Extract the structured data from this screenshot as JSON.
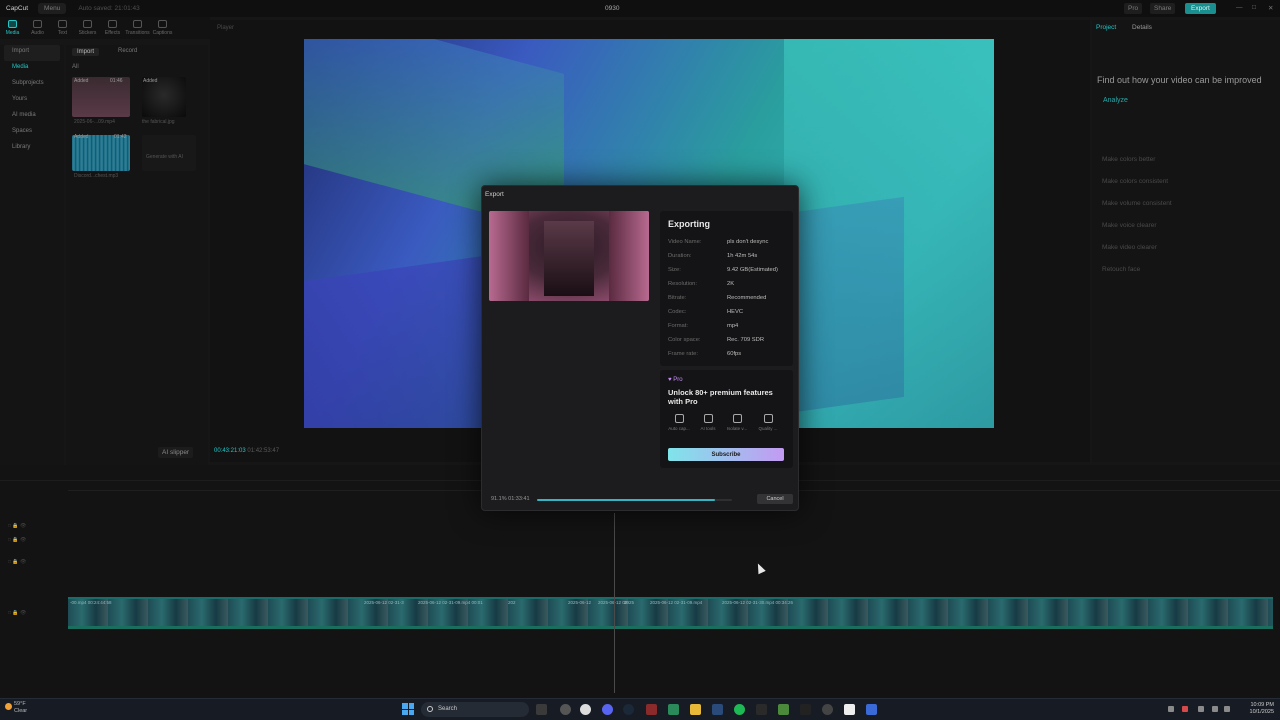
{
  "titlebar": {
    "app_name": "CapCut",
    "menu_label": "Menu",
    "autosave": "Auto saved: 21:01:43",
    "project_title": "0930",
    "pro_label": "Pro",
    "share_label": "Share",
    "export_label": "Export"
  },
  "tool_tabs": [
    "Media",
    "Audio",
    "Text",
    "Stickers",
    "Effects",
    "Transitions",
    "Captions"
  ],
  "left_nav": {
    "import_label": "Import",
    "items": [
      "Media",
      "Subprojects",
      "Yours",
      "AI media",
      "Spaces",
      "Library"
    ]
  },
  "media_panel": {
    "import_btn": "Import",
    "record_btn": "Record",
    "filter_label": "All",
    "items": [
      {
        "badge": "Added",
        "duration": "01:46",
        "caption": "2025-06-...09.mp4"
      },
      {
        "badge": "Added",
        "duration": "",
        "caption": "the fabrical.jpg"
      },
      {
        "badge": "Added",
        "duration": "01:42",
        "caption": "Discord...chest.mp3"
      },
      {
        "badge": "",
        "duration": "",
        "caption": "Generate with AI"
      }
    ],
    "ai_slipper": "AI slipper"
  },
  "player": {
    "label": "Player",
    "current_time": "00:43:21:03",
    "total_time": "01:42:53:47"
  },
  "right_panel": {
    "tabs": [
      "Project",
      "Details"
    ],
    "heading": "Find out how your video can be improved",
    "analyze_label": "Analyze",
    "items": [
      "Make colors better",
      "Make colors consistent",
      "Make volume consistent",
      "Make voice clearer",
      "Make video clearer",
      "Retouch face"
    ]
  },
  "timeline": {
    "clip_labels": [
      "-00.mp4  00:24:44:58",
      "2025-06-12 02-31-3",
      "2025-06-12 02-31-09.mp4  00:01",
      "202",
      "2025-06-12",
      "2025-06-12 02-",
      "2025",
      "2025-06-12 02-31-09.mp4",
      "2025-06-12 02-31-30.mp4  00:34:26"
    ]
  },
  "export_dialog": {
    "title": "Export",
    "status_heading": "Exporting",
    "rows": [
      {
        "k": "Video Name:",
        "v": "pls don't desync"
      },
      {
        "k": "Duration:",
        "v": "1h 42m 54s"
      },
      {
        "k": "Size:",
        "v": "9.42 GB(Estimated)"
      },
      {
        "k": "Resolution:",
        "v": "2K"
      },
      {
        "k": "Bitrate:",
        "v": "Recommended"
      },
      {
        "k": "Codec:",
        "v": "HEVC"
      },
      {
        "k": "Format:",
        "v": "mp4"
      },
      {
        "k": "Color space:",
        "v": "Rec. 709 SDR"
      },
      {
        "k": "Frame rate:",
        "v": "60fps"
      }
    ],
    "pro_badge": "Pro",
    "pro_heading": "Unlock 80+ premium features with Pro",
    "features": [
      "Auto cap...",
      "AI tools",
      "Isolate v...",
      "Quality ..."
    ],
    "subscribe_label": "Subscribe",
    "progress_percent": "91.1%",
    "progress_time": "01:33:41",
    "progress_value": 0.911,
    "cancel_label": "Cancel"
  },
  "taskbar": {
    "temperature": "59°F",
    "condition": "Clear",
    "search_placeholder": "Search",
    "time": "10:09 PM",
    "date": "10/1/2025"
  },
  "colors": {
    "accent": "#26c6c6",
    "export_button": "#1a8f8f",
    "progress_fill": "#36b4c4",
    "pro_purple": "#c28cf5"
  }
}
